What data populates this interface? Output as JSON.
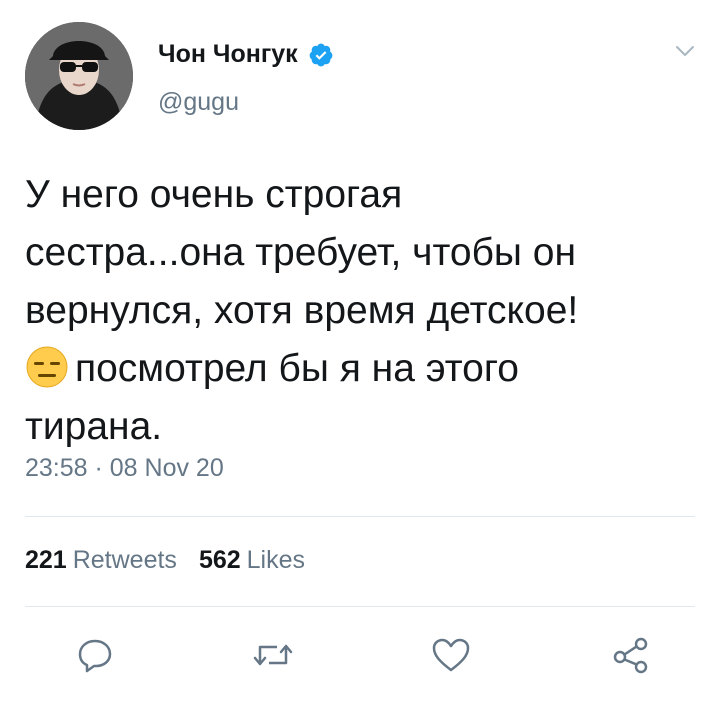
{
  "author": {
    "display_name": "Чон Чонгук",
    "handle": "@gugu",
    "verified": true,
    "avatar_icon": "profile-photo"
  },
  "tweet": {
    "text_line1": "У него очень строгая",
    "text_line2": "сестра...она требует, чтобы он",
    "text_line3": "вернулся, хотя время детское!",
    "emoji": "😑",
    "text_line4": "посмотрел бы я на этого",
    "text_line5": "тирана.",
    "timestamp": "23:58 · 08 Nov 20"
  },
  "stats": {
    "retweets_count": "221",
    "retweets_label": "Retweets",
    "likes_count": "562",
    "likes_label": "Likes"
  },
  "actions": {
    "reply_icon": "reply-icon",
    "retweet_icon": "retweet-icon",
    "like_icon": "heart-icon",
    "share_icon": "share-icon"
  },
  "colors": {
    "text": "#14171a",
    "secondary": "#657786",
    "verified": "#1da1f2",
    "divider": "#e1e8ed"
  }
}
